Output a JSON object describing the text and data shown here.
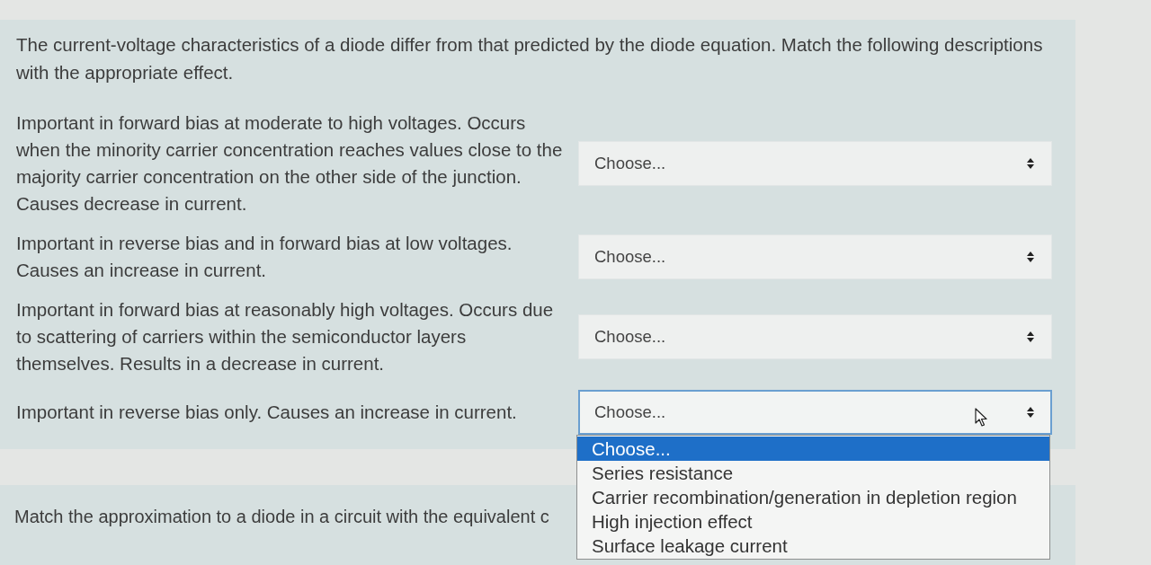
{
  "intro": "The current-voltage characteristics of a diode differ from that predicted by the diode equation. Match the following descriptions with the appropriate effect.",
  "matches": [
    {
      "description": "Important in forward bias at moderate to high voltages. Occurs when the minority carrier concentration reaches values close to the majority carrier concentration on the other side of the junction. Causes decrease in current.",
      "value": "Choose...",
      "expanded": false
    },
    {
      "description": "Important in reverse bias and in forward bias at low voltages. Causes an increase in current.",
      "value": "Choose...",
      "expanded": false
    },
    {
      "description": "Important in forward bias at reasonably high voltages. Occurs due to scattering of carriers within the semiconductor layers themselves. Results in a decrease in current.",
      "value": "Choose...",
      "expanded": false
    },
    {
      "description": "Important in reverse bias only. Causes an increase in current.",
      "value": "Choose...",
      "expanded": true,
      "options": [
        {
          "label": "Choose...",
          "selected": true
        },
        {
          "label": "Series resistance",
          "selected": false
        },
        {
          "label": "Carrier recombination/generation in depletion region",
          "selected": false
        },
        {
          "label": "High injection effect",
          "selected": false
        },
        {
          "label": "Surface leakage current",
          "selected": false
        }
      ]
    }
  ],
  "next_question": {
    "text": "Match the approximation to a diode in a circuit with the equivalent c"
  }
}
